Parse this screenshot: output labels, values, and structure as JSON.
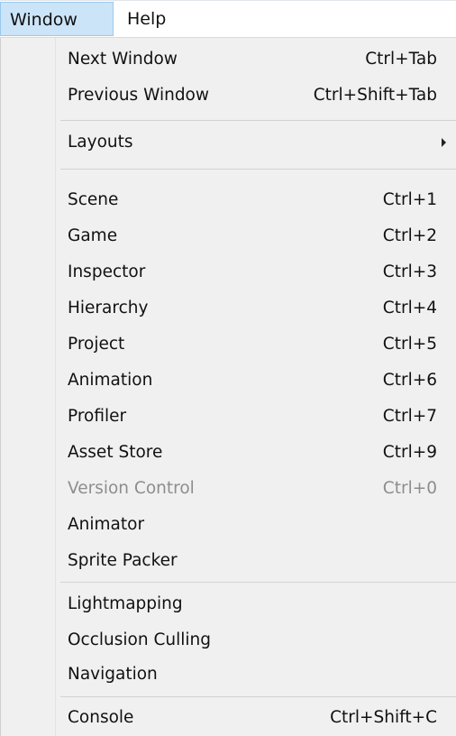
{
  "menubar": {
    "items": [
      {
        "label": "Window"
      },
      {
        "label": "Help"
      }
    ]
  },
  "menu": {
    "items": [
      {
        "label": "Next Window",
        "shortcut": "Ctrl+Tab"
      },
      {
        "label": "Previous Window",
        "shortcut": "Ctrl+Shift+Tab"
      },
      {
        "label": "Layouts",
        "submenu": true
      },
      {
        "label": "Scene",
        "shortcut": "Ctrl+1"
      },
      {
        "label": "Game",
        "shortcut": "Ctrl+2"
      },
      {
        "label": "Inspector",
        "shortcut": "Ctrl+3"
      },
      {
        "label": "Hierarchy",
        "shortcut": "Ctrl+4"
      },
      {
        "label": "Project",
        "shortcut": "Ctrl+5"
      },
      {
        "label": "Animation",
        "shortcut": "Ctrl+6"
      },
      {
        "label": "Profiler",
        "shortcut": "Ctrl+7"
      },
      {
        "label": "Asset Store",
        "shortcut": "Ctrl+9"
      },
      {
        "label": "Version Control",
        "shortcut": "Ctrl+0",
        "disabled": true
      },
      {
        "label": "Animator",
        "shortcut": ""
      },
      {
        "label": "Sprite Packer",
        "shortcut": ""
      },
      {
        "label": "Lightmapping",
        "shortcut": ""
      },
      {
        "label": "Occlusion Culling",
        "shortcut": ""
      },
      {
        "label": "Navigation",
        "shortcut": ""
      },
      {
        "label": "Console",
        "shortcut": "Ctrl+Shift+C"
      }
    ]
  },
  "colors": {
    "active_menu_bg": "#cce4f7",
    "active_menu_border": "#99c9ef",
    "menu_bg": "#f0f0f0",
    "disabled_text": "#8d8d8d"
  }
}
